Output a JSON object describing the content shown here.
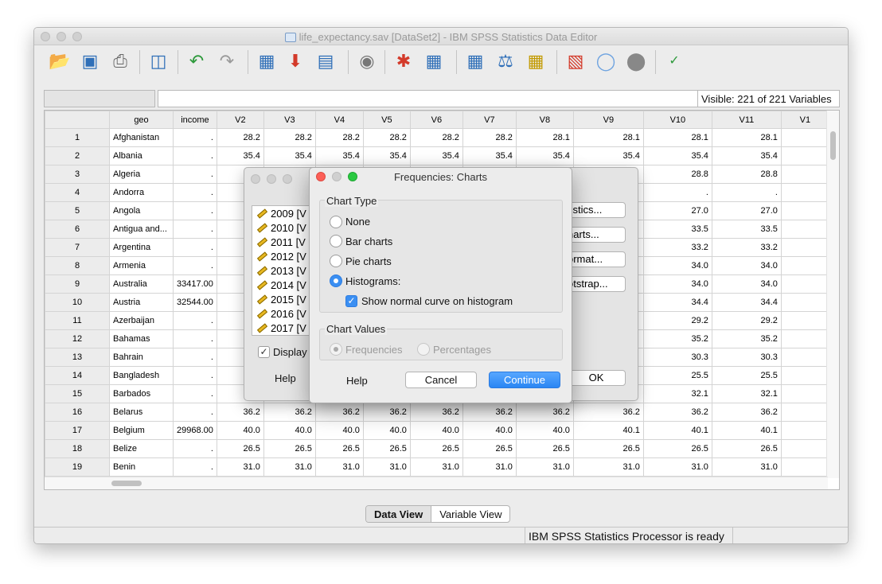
{
  "window": {
    "title": "life_expectancy.sav [DataSet2] - IBM SPSS Statistics Data Editor",
    "visible_vars": "Visible: 221 of 221 Variables",
    "status": "IBM SPSS Statistics Processor is ready",
    "view_tabs": {
      "data": "Data View",
      "variable": "Variable View"
    }
  },
  "toolbar_icons": [
    "open-folder-icon",
    "save-icon",
    "print-icon",
    "recall-dialog-icon",
    "undo-icon",
    "redo-icon",
    "goto-case-icon",
    "goto-variable-icon",
    "variables-icon",
    "find-icon",
    "insert-cases-icon",
    "insert-variable-icon",
    "split-file-icon",
    "weight-cases-icon",
    "select-cases-icon",
    "value-labels-icon",
    "use-sets-icon",
    "show-all-variables-icon",
    "spell-check-icon"
  ],
  "grid": {
    "columns": [
      "geo",
      "income",
      "V2",
      "V3",
      "V4",
      "V5",
      "V6",
      "V7",
      "V8",
      "V9",
      "V10",
      "V11",
      "V1"
    ],
    "rows": [
      {
        "n": "1",
        "geo": "Afghanistan",
        "income": ".",
        "v": [
          "28.2",
          "28.2",
          "28.2",
          "28.2",
          "28.2",
          "28.2",
          "28.1",
          "28.1",
          "28.1",
          "28.1"
        ]
      },
      {
        "n": "2",
        "geo": "Albania",
        "income": ".",
        "v": [
          "35.4",
          "35.4",
          "35.4",
          "35.4",
          "35.4",
          "35.4",
          "35.4",
          "35.4",
          "35.4",
          "35.4"
        ]
      },
      {
        "n": "3",
        "geo": "Algeria",
        "income": ".",
        "v": [
          "",
          "",
          "",
          "",
          "",
          "",
          "",
          "",
          "28.8",
          "28.8"
        ]
      },
      {
        "n": "4",
        "geo": "Andorra",
        "income": ".",
        "v": [
          "",
          "",
          "",
          "",
          "",
          "",
          "",
          "",
          ".",
          "."
        ]
      },
      {
        "n": "5",
        "geo": "Angola",
        "income": ".",
        "v": [
          "",
          "",
          "",
          "",
          "",
          "",
          "",
          "",
          "27.0",
          "27.0"
        ]
      },
      {
        "n": "6",
        "geo": "Antigua and...",
        "income": ".",
        "v": [
          "",
          "",
          "",
          "",
          "",
          "",
          "",
          "",
          "33.5",
          "33.5"
        ]
      },
      {
        "n": "7",
        "geo": "Argentina",
        "income": ".",
        "v": [
          "",
          "",
          "",
          "",
          "",
          "",
          "",
          "",
          "33.2",
          "33.2"
        ]
      },
      {
        "n": "8",
        "geo": "Armenia",
        "income": ".",
        "v": [
          "",
          "",
          "",
          "",
          "",
          "",
          "",
          "",
          "34.0",
          "34.0"
        ]
      },
      {
        "n": "9",
        "geo": "Australia",
        "income": "33417.00",
        "v": [
          "",
          "",
          "",
          "",
          "",
          "",
          "",
          "",
          "34.0",
          "34.0"
        ]
      },
      {
        "n": "10",
        "geo": "Austria",
        "income": "32544.00",
        "v": [
          "",
          "",
          "",
          "",
          "",
          "",
          "",
          "",
          "34.4",
          "34.4"
        ]
      },
      {
        "n": "11",
        "geo": "Azerbaijan",
        "income": ".",
        "v": [
          "",
          "",
          "",
          "",
          "",
          "",
          "",
          "",
          "29.2",
          "29.2"
        ]
      },
      {
        "n": "12",
        "geo": "Bahamas",
        "income": ".",
        "v": [
          "",
          "",
          "",
          "",
          "",
          "",
          "",
          "",
          "35.2",
          "35.2"
        ]
      },
      {
        "n": "13",
        "geo": "Bahrain",
        "income": ".",
        "v": [
          "",
          "",
          "",
          "",
          "",
          "",
          "",
          "",
          "30.3",
          "30.3"
        ]
      },
      {
        "n": "14",
        "geo": "Bangladesh",
        "income": ".",
        "v": [
          "",
          "",
          "",
          "",
          "",
          "",
          "",
          "",
          "25.5",
          "25.5"
        ]
      },
      {
        "n": "15",
        "geo": "Barbados",
        "income": ".",
        "v": [
          "",
          "",
          "",
          "",
          "",
          "",
          "",
          "",
          "32.1",
          "32.1"
        ]
      },
      {
        "n": "16",
        "geo": "Belarus",
        "income": ".",
        "v": [
          "36.2",
          "36.2",
          "36.2",
          "36.2",
          "36.2",
          "36.2",
          "36.2",
          "36.2",
          "36.2",
          "36.2"
        ]
      },
      {
        "n": "17",
        "geo": "Belgium",
        "income": "29968.00",
        "v": [
          "40.0",
          "40.0",
          "40.0",
          "40.0",
          "40.0",
          "40.0",
          "40.0",
          "40.1",
          "40.1",
          "40.1"
        ]
      },
      {
        "n": "18",
        "geo": "Belize",
        "income": ".",
        "v": [
          "26.5",
          "26.5",
          "26.5",
          "26.5",
          "26.5",
          "26.5",
          "26.5",
          "26.5",
          "26.5",
          "26.5"
        ]
      },
      {
        "n": "19",
        "geo": "Benin",
        "income": ".",
        "v": [
          "31.0",
          "31.0",
          "31.0",
          "31.0",
          "31.0",
          "31.0",
          "31.0",
          "31.0",
          "31.0",
          "31.0"
        ]
      }
    ]
  },
  "frequencies_dialog": {
    "variables": [
      "2009 [V",
      "2010 [V",
      "2011 [V",
      "2012 [V",
      "2013 [V",
      "2014 [V",
      "2015 [V",
      "2016 [V",
      "2017 [V"
    ],
    "buttons": {
      "statistics": "tistics...",
      "charts": "harts...",
      "format": "ormat...",
      "bootstrap": "otstrap...",
      "ok": "OK",
      "help": "Help"
    },
    "display_label": "Display"
  },
  "charts_dialog": {
    "title": "Frequencies: Charts",
    "chart_type_label": "Chart Type",
    "options": {
      "none": "None",
      "bar": "Bar charts",
      "pie": "Pie charts",
      "hist": "Histograms:"
    },
    "normal_curve": "Show normal curve on histogram",
    "chart_values_label": "Chart Values",
    "values": {
      "freq": "Frequencies",
      "pct": "Percentages"
    },
    "buttons": {
      "help": "Help",
      "cancel": "Cancel",
      "continue": "Continue"
    }
  }
}
